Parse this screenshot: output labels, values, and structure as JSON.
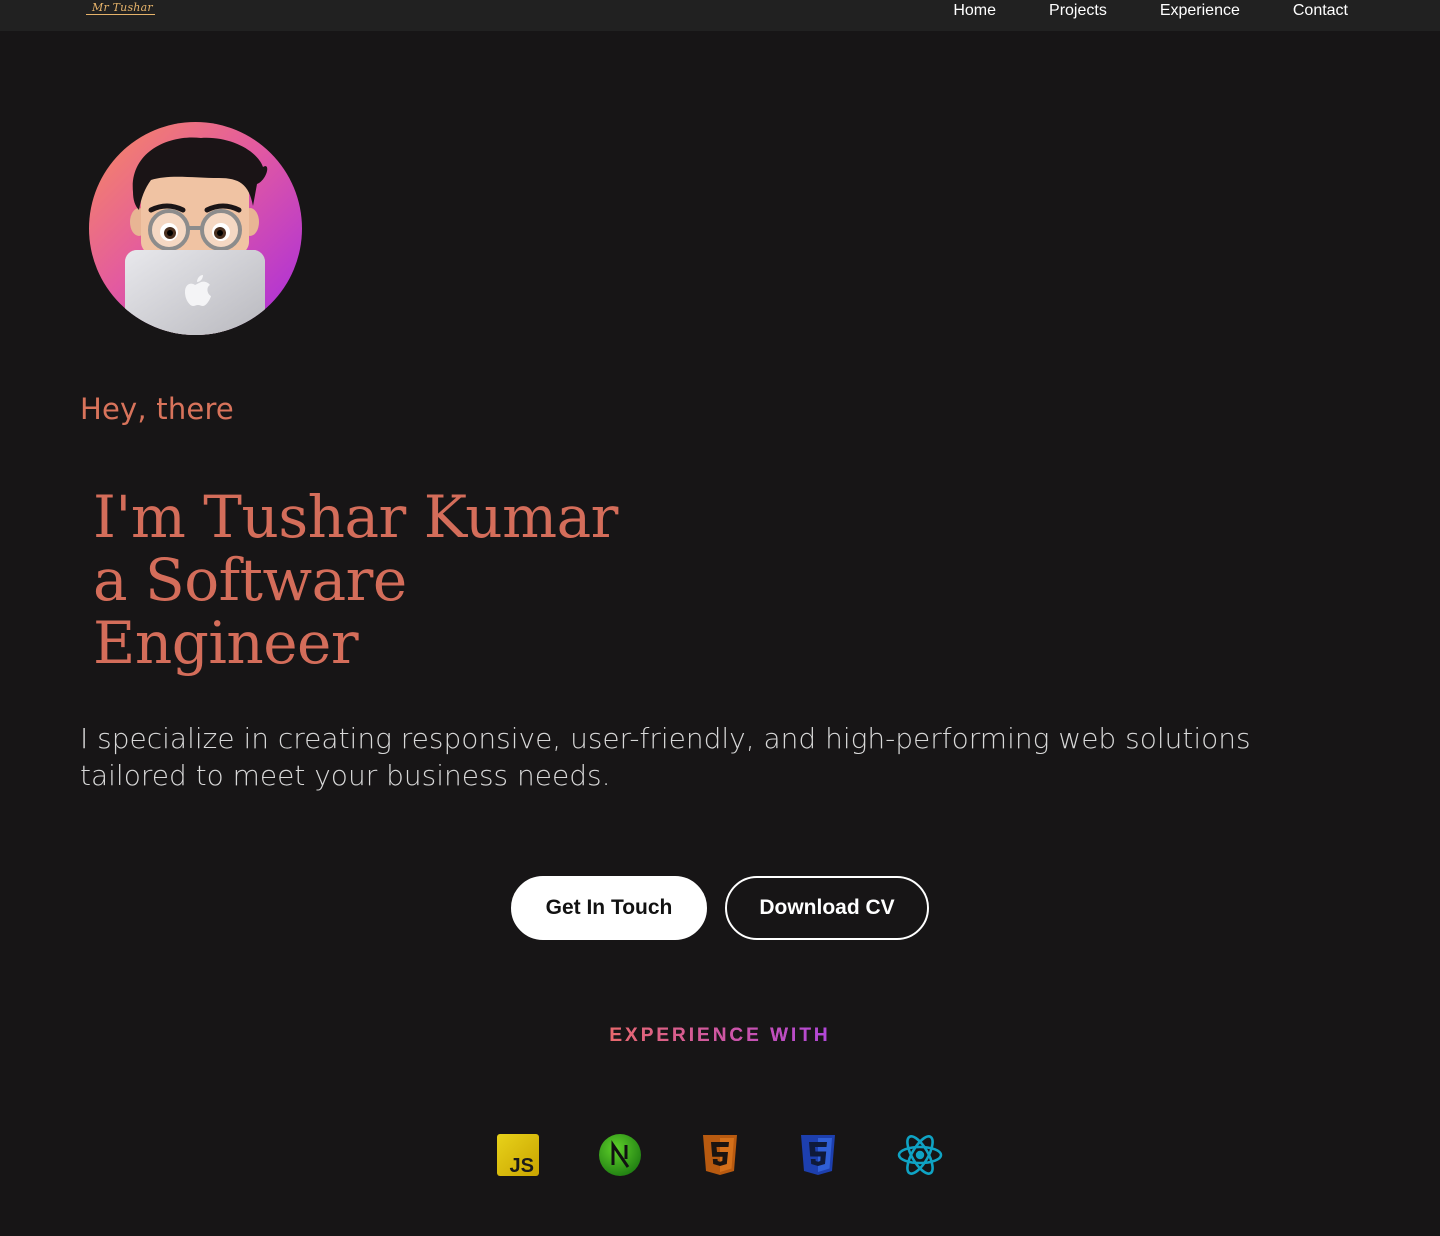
{
  "nav": {
    "logo": "Mr Tushar",
    "links": [
      "Home",
      "Projects",
      "Experience",
      "Contact"
    ]
  },
  "hero": {
    "avatar_icon": "memoji-avatar",
    "greeting": "Hey, there",
    "headline": [
      "I'm Tushar Kumar",
      "a Software",
      "Engineer"
    ],
    "intro": "I specialize in creating responsive, user-friendly, and high-performing web solutions tailored to meet your business needs.",
    "buttons": {
      "primary": "Get In Touch",
      "secondary": "Download CV"
    }
  },
  "experience": {
    "heading": "EXPERIENCE WITH",
    "tech": [
      "javascript-icon",
      "nextjs-icon",
      "html5-icon",
      "css3-icon",
      "react-icon"
    ]
  },
  "colors": {
    "background": "#171516",
    "navbar": "#212121",
    "accent": "#d46d5a",
    "heading_gradient_start": "#e8696c",
    "heading_gradient_end": "#b046dc"
  }
}
